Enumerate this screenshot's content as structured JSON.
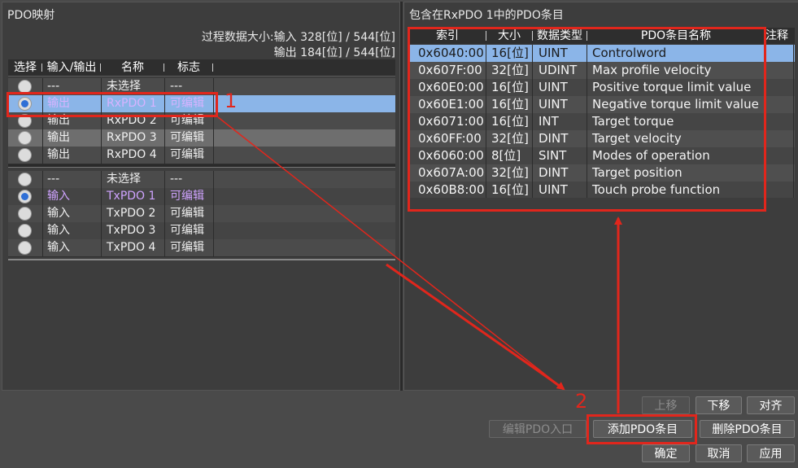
{
  "left_panel": {
    "title": "PDO映射",
    "summary": {
      "line1": "过程数据大小:输入  328[位]  /  544[位]",
      "line2": "输出  184[位]  /  544[位]"
    },
    "columns": [
      "选择",
      "输入/输出",
      "名称",
      "标志"
    ],
    "rx_rows": [
      {
        "io": "---",
        "name": "未选择",
        "flag": "---",
        "selected": false
      },
      {
        "io": "输出",
        "name": "RxPDO 1",
        "flag": "可编辑",
        "selected": true
      },
      {
        "io": "输出",
        "name": "RxPDO 2",
        "flag": "可编辑",
        "selected": false
      },
      {
        "io": "输出",
        "name": "RxPDO 3",
        "flag": "可编辑",
        "selected": false
      },
      {
        "io": "输出",
        "name": "RxPDO 4",
        "flag": "可编辑",
        "selected": false
      }
    ],
    "tx_rows": [
      {
        "io": "---",
        "name": "未选择",
        "flag": "---",
        "selected": false
      },
      {
        "io": "输入",
        "name": "TxPDO 1",
        "flag": "可编辑",
        "selected": true
      },
      {
        "io": "输入",
        "name": "TxPDO 2",
        "flag": "可编辑",
        "selected": false
      },
      {
        "io": "输入",
        "name": "TxPDO 3",
        "flag": "可编辑",
        "selected": false
      },
      {
        "io": "输入",
        "name": "TxPDO 4",
        "flag": "可编辑",
        "selected": false
      }
    ]
  },
  "right_panel": {
    "title": "包含在RxPDO 1中的PDO条目",
    "columns": [
      "索引",
      "大小",
      "数据类型",
      "PDO条目名称",
      "注释"
    ],
    "entries": [
      {
        "index": "0x6040:00",
        "size": "16[位]",
        "type": "UINT",
        "name": "Controlword"
      },
      {
        "index": "0x607F:00",
        "size": "32[位]",
        "type": "UDINT",
        "name": "Max profile velocity"
      },
      {
        "index": "0x60E0:00",
        "size": "16[位]",
        "type": "UINT",
        "name": "Positive torque limit value"
      },
      {
        "index": "0x60E1:00",
        "size": "16[位]",
        "type": "UINT",
        "name": "Negative torque limit value"
      },
      {
        "index": "0x6071:00",
        "size": "16[位]",
        "type": "INT",
        "name": "Target torque"
      },
      {
        "index": "0x60FF:00",
        "size": "32[位]",
        "type": "DINT",
        "name": "Target velocity"
      },
      {
        "index": "0x6060:00",
        "size": "8[位]",
        "type": "SINT",
        "name": "Modes of operation"
      },
      {
        "index": "0x607A:00",
        "size": "32[位]",
        "type": "DINT",
        "name": "Target position"
      },
      {
        "index": "0x60B8:00",
        "size": "16[位]",
        "type": "UINT",
        "name": "Touch probe function"
      }
    ]
  },
  "buttons": {
    "move_up": "上移",
    "move_down": "下移",
    "align": "对齐",
    "edit_pdo_entry": "编辑PDO入口",
    "add_pdo_entry": "添加PDO条目",
    "delete_pdo_entry": "删除PDO条目",
    "ok": "确定",
    "cancel": "取消",
    "apply": "应用"
  },
  "annotations": {
    "label1": "1",
    "label2": "2",
    "color": "#e1261c"
  }
}
